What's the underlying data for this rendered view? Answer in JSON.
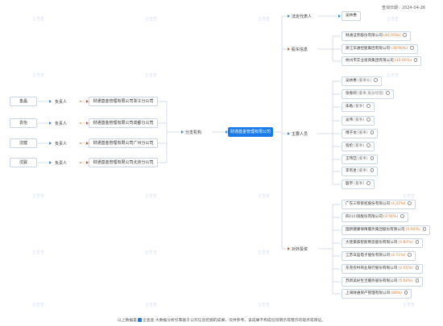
{
  "header": {
    "date_label": "查询日期：",
    "date": "2024-04-26"
  },
  "center": "财通基金管理有限公司",
  "branches": {
    "legal_rep": "法定代表人",
    "shareholders": "股东信息",
    "key_personnel": "主要人员",
    "investments": "对外投资",
    "branch_offices": "分支机构",
    "person_in_charge": "负责人"
  },
  "legal_rep_names": [
    "吴林惠"
  ],
  "shareholders": [
    {
      "name": "财通证券股份有限公司",
      "pct": "40.00%"
    },
    {
      "name": "浙江华通控股集团有限公司",
      "pct": "30.00%"
    },
    {
      "name": "杭州市实业投资集团有限公司",
      "pct": "30.00%"
    }
  ],
  "personnel": [
    {
      "name": "吴林惠",
      "role": "董事长"
    },
    {
      "name": "张春莉",
      "role": "董事,兼总经理"
    },
    {
      "name": "朱皓",
      "role": "董事"
    },
    {
      "name": "吴伟",
      "role": "董事"
    },
    {
      "name": "傅子龙",
      "role": "董事"
    },
    {
      "name": "程伦",
      "role": "董事"
    },
    {
      "name": "王玮喆",
      "role": "董事"
    },
    {
      "name": "李有星",
      "role": "董事"
    },
    {
      "name": "殷宇",
      "role": "董事"
    }
  ],
  "investments": [
    {
      "name": "广东三和管桩股份有限公司",
      "pct": "4.22%"
    },
    {
      "name": "四川川润股份有限公司",
      "pct": "3.56%"
    },
    {
      "name": "国新健康保障服务集团股份有限公司",
      "pct": "0.93%"
    },
    {
      "name": "大连豪森智能制造股份有限公司",
      "pct": "4.83%"
    },
    {
      "name": "江苏日盈电子股份有限公司",
      "pct": "4.71%"
    },
    {
      "name": "东莞农村商业银行股份有限公司",
      "pct": "2.55%"
    },
    {
      "name": "苏新美好生活服务股份有限公司",
      "pct": "5.56%"
    },
    {
      "name": "上海财通资产管理有限公司",
      "pct": "80%"
    }
  ],
  "branch_list": [
    {
      "person": "金晶",
      "company": "财通基金管理有限公司浙江分公司"
    },
    {
      "person": "袁怡",
      "company": "财通基金管理有限公司成都分公司"
    },
    {
      "person": "沈健",
      "company": "财通基金管理有限公司广州分公司"
    },
    {
      "person": "沈骏",
      "company": "财通基金管理有限公司北京分公司"
    }
  ],
  "footer": {
    "prefix": "以上数据是",
    "brand": "企查查",
    "text": "大数据分析引擎基于公开信息挖掘的成果，仅供参考。该成果不构成任何明示或暗示的观点或保证。"
  },
  "watermark": "企查查",
  "colors": {
    "accent": "#1a7ae6",
    "percent": "#e67a2e",
    "line": "#c9d6e6",
    "arrow_red": "#e05a2a",
    "arrow_blue": "#3b8be0"
  }
}
